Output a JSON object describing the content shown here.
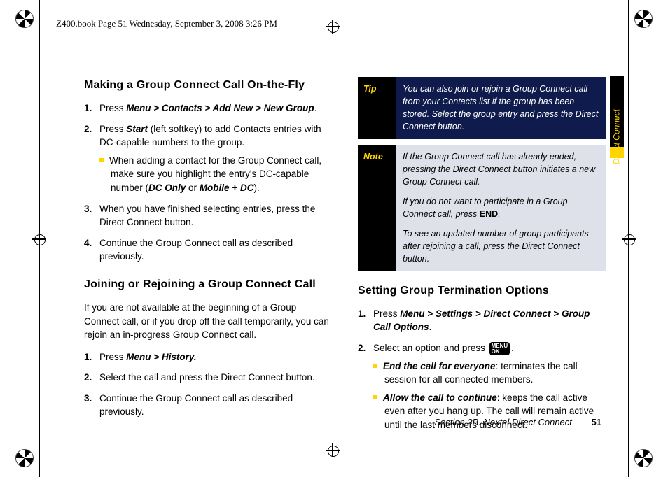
{
  "header": {
    "filepath_line": "Z400.book  Page 51  Wednesday, September 3, 2008  3:26 PM"
  },
  "sidetab": {
    "label": "Direct Connect"
  },
  "left": {
    "h1": "Making a Group Connect Call On-the-Fly",
    "s1_prefix": "Press ",
    "s1_path": "Menu > Contacts > Add New > New Group",
    "s1_suffix": ".",
    "s2a": "Press ",
    "s2_start": "Start",
    "s2b": " (left softkey) to add Contacts entries with DC-capable numbers to the group.",
    "s2_sub_a": "When adding a contact for the Group Connect call, make sure you highlight the entry's DC-capable number (",
    "s2_sub_dc": "DC Only",
    "s2_sub_or": " or ",
    "s2_sub_mob": "Mobile + DC",
    "s2_sub_b": ").",
    "s3": "When you have finished selecting entries, press the Direct Connect button.",
    "s4": "Continue the Group Connect call as described previously.",
    "h2": "Joining or Rejoining a Group Connect Call",
    "lead": "If you are not available at the beginning of a Group Connect call, or if you drop off the call temporarily, you can rejoin an in-progress Group Connect call.",
    "j1_prefix": "Press ",
    "j1_path": "Menu > History.",
    "j2": "Select the call and press the Direct Connect button.",
    "j3": "Continue the Group Connect call as described previously."
  },
  "right": {
    "tip_label": "Tip",
    "tip_body": "You can also join or rejoin a Group Connect call from your Contacts list if the group has been stored. Select the group entry and press the Direct Connect button.",
    "note_label": "Note",
    "note_p1": "If the Group Connect call has already ended, pressing the Direct Connect button initiates a new Group Connect call.",
    "note_p2a": "If you do not want to participate in a Group Connect call, press ",
    "note_end": "END",
    "note_p2b": ".",
    "note_p3": "To see an updated number of group participants after rejoining a call, press the Direct Connect button.",
    "h3": "Setting Group Termination Options",
    "t1_prefix": "Press ",
    "t1_path": "Menu > Settings > Direct Connect > Group Call Options",
    "t1_suffix": ".",
    "t2a": "Select an option and press ",
    "t2b": ".",
    "menuok_top": "MENU",
    "menuok_bot": "OK",
    "opt1_label": "End the call for everyone",
    "opt1_body": ": terminates the call session for all connected members.",
    "opt2_label": "Allow the call to continue",
    "opt2_body": ": keeps the call active even after you hang up. The call will remain active until the last members disconnect."
  },
  "footer": {
    "section": "Section 2B. Nextel Direct Connect",
    "page": "51"
  }
}
